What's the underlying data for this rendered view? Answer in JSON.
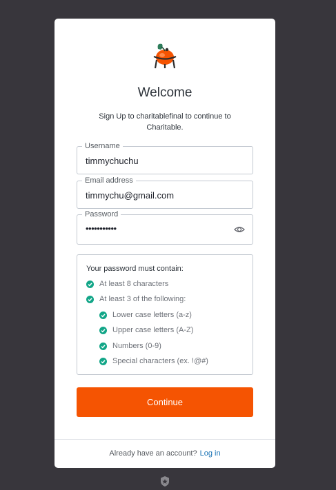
{
  "header": {
    "title": "Welcome",
    "subtitle": "Sign Up to charitablefinal to continue to Charitable."
  },
  "form": {
    "username": {
      "label": "Username",
      "value": "timmychuchu"
    },
    "email": {
      "label": "Email address",
      "value": "timmychu@gmail.com"
    },
    "password": {
      "label": "Password",
      "value": "•••••••••••",
      "toggle_icon": "eye-icon"
    }
  },
  "rules": {
    "heading": "Your password must contain:",
    "items": [
      {
        "text": "At least 8 characters",
        "met": true
      },
      {
        "text": "At least 3 of the following:",
        "met": true
      },
      {
        "text": "Lower case letters (a-z)",
        "met": true
      },
      {
        "text": "Upper case letters (A-Z)",
        "met": true
      },
      {
        "text": "Numbers (0-9)",
        "met": true
      },
      {
        "text": "Special characters (ex. !@#)",
        "met": true
      }
    ]
  },
  "actions": {
    "continue_label": "Continue"
  },
  "footer": {
    "prompt": "Already have an account?",
    "login_label": "Log in"
  },
  "colors": {
    "background": "#38363c",
    "accent": "#f55402",
    "link": "#1a73b5",
    "success": "#13a688"
  }
}
